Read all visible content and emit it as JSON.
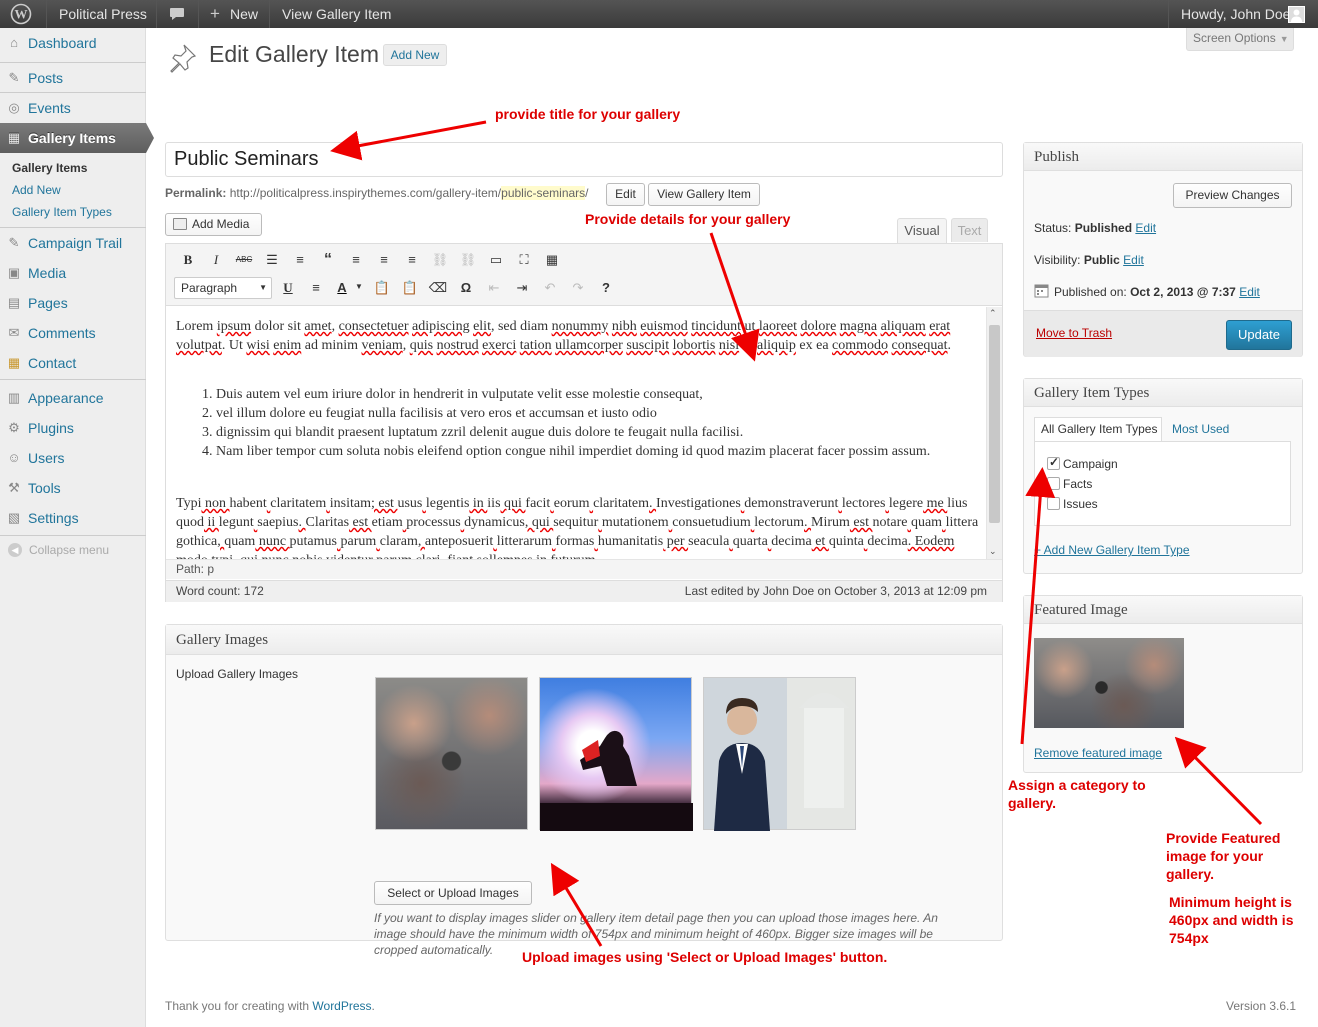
{
  "adminbar": {
    "site_name": "Political Press",
    "new_label": "New",
    "view_item": "View Gallery Item",
    "howdy": "Howdy, John Doe"
  },
  "sidebar": {
    "items": [
      {
        "label": "Dashboard",
        "icon": "⌂"
      },
      {
        "label": "Posts",
        "icon": "✎"
      },
      {
        "label": "Events",
        "icon": "◎"
      },
      {
        "label": "Gallery Items",
        "icon": "▦"
      },
      {
        "label": "Campaign Trail",
        "icon": "✎"
      },
      {
        "label": "Media",
        "icon": "▣"
      },
      {
        "label": "Pages",
        "icon": "▤"
      },
      {
        "label": "Comments",
        "icon": "✉"
      },
      {
        "label": "Contact",
        "icon": "▦"
      },
      {
        "label": "Appearance",
        "icon": "▥"
      },
      {
        "label": "Plugins",
        "icon": "⚙"
      },
      {
        "label": "Users",
        "icon": "☺"
      },
      {
        "label": "Tools",
        "icon": "⚒"
      },
      {
        "label": "Settings",
        "icon": "▧"
      }
    ],
    "submenu": [
      "Gallery Items",
      "Add New",
      "Gallery Item Types"
    ],
    "collapse": "Collapse menu"
  },
  "page": {
    "title": "Edit Gallery Item",
    "add_new": "Add New",
    "screen_options": "Screen Options",
    "post_title": "Public Seminars",
    "permalink_label": "Permalink:",
    "permalink_base": "http://politicalpress.inspirythemes.com/gallery-item/",
    "permalink_slug": "public-seminars",
    "permalink_end": "/",
    "edit_btn": "Edit",
    "view_btn": "View Gallery Item",
    "add_media": "Add Media",
    "tab_visual": "Visual",
    "tab_text": "Text",
    "format_select": "Paragraph"
  },
  "editor": {
    "p1_parts": [
      "Lorem ",
      "ipsum",
      " dolor sit ",
      "amet",
      ", ",
      "consectetuer",
      " ",
      "adipiscing",
      " ",
      "elit",
      ", sed diam ",
      "nonummy",
      " ",
      "nibh",
      " ",
      "euismod",
      " ",
      "tincidunt",
      " ut ",
      "laoreet",
      " ",
      "dolore",
      " ",
      "magna",
      " ",
      "aliquam",
      " ",
      "erat",
      " ",
      "volutpat",
      ". Ut ",
      "wisi",
      " ",
      "enim",
      " ad minim ",
      "veniam",
      ", ",
      "quis",
      " ",
      "nostrud",
      " ",
      "exerci",
      " ",
      "tation",
      " ",
      "ullamcorper",
      " ",
      "suscipit",
      " ",
      "lobortis",
      " ",
      "nisl",
      " ut ",
      "aliquip",
      " ex ea ",
      "commodo",
      " ",
      "consequat",
      "."
    ],
    "list": [
      "Duis autem vel eum iriure dolor in hendrerit in vulputate velit esse molestie consequat,",
      "vel illum dolore eu feugiat nulla facilisis at vero eros et accumsan et iusto odio",
      "dignissim qui blandit praesent luptatum zzril delenit augue duis dolore te feugait nulla facilisi.",
      "Nam liber tempor cum soluta nobis eleifend option congue nihil imperdiet doming id quod mazim placerat facer possim assum."
    ],
    "p2_parts": [
      "Typi",
      " non ",
      "habent",
      " ",
      "claritatem",
      " ",
      "insitam",
      "; est ",
      "usus",
      " ",
      "legentis",
      " in ",
      "iis",
      " qui ",
      "facit",
      " ",
      "eorum",
      " ",
      "claritatem",
      ". ",
      "Investigationes",
      " ",
      "demonstraverunt",
      " ",
      "lectores",
      " ",
      "legere",
      " me ",
      "lius",
      " ",
      "quod",
      " ii ",
      "legunt",
      " ",
      "saepius",
      ". ",
      "Claritas",
      " est ",
      "etiam",
      " ",
      "processus",
      " ",
      "dynamicus",
      ", qui ",
      "sequitur",
      " ",
      "mutationem",
      " ",
      "consuetudium",
      " ",
      "lectorum",
      ". ",
      "Mirum",
      " est ",
      "notare",
      " ",
      "quam",
      " ",
      "littera",
      " ",
      "gothica",
      ", ",
      "quam",
      " nunc ",
      "putamus",
      " ",
      "parum",
      " ",
      "claram",
      ", ",
      "anteposuerit",
      " ",
      "litterarum",
      " ",
      "formas",
      " ",
      "humanitatis",
      " per ",
      "seacula",
      " ",
      "quarta",
      " ",
      "decima",
      " et ",
      "quinta",
      " ",
      "decima",
      ". Eodem modo ",
      "typi",
      ", qui nunc ",
      "nobis",
      " ",
      "videntur",
      " ",
      "parum",
      " ",
      "clari",
      ", fiant ",
      "sollemnes",
      " in ",
      "futurum",
      "."
    ],
    "path": "Path: p",
    "word_count": "Word count: 172",
    "last_edited": "Last edited by John Doe on October 3, 2013 at 12:09 pm"
  },
  "gallery": {
    "title": "Gallery Images",
    "upload_label": "Upload Gallery Images",
    "button": "Select or Upload Images",
    "help": "If you want to display images slider on gallery item detail page then you can upload those images here. An image should have the minimum width of 754px and minimum height of 460px. Bigger size images will be cropped automatically."
  },
  "publish": {
    "title": "Publish",
    "preview": "Preview Changes",
    "status_label": "Status:",
    "status_value": "Published",
    "visibility_label": "Visibility:",
    "visibility_value": "Public",
    "published_label": "Published on:",
    "published_value": "Oct 2, 2013 @ 7:37",
    "edit": "Edit",
    "trash": "Move to Trash",
    "update": "Update"
  },
  "types": {
    "title": "Gallery Item Types",
    "tab_all": "All Gallery Item Types",
    "tab_used": "Most Used",
    "options": [
      {
        "label": "Campaign",
        "checked": true
      },
      {
        "label": "Facts",
        "checked": false
      },
      {
        "label": "Issues",
        "checked": false
      }
    ],
    "add_new": "+ Add New Gallery Item Type"
  },
  "featured": {
    "title": "Featured Image",
    "remove": "Remove featured image"
  },
  "annotations": {
    "title": "provide title for your gallery",
    "details": "Provide details for your gallery",
    "category": "Assign a category to gallery.",
    "featured": "Provide Featured image for your gallery.",
    "size": "Minimum height is 460px and width is 754px",
    "upload": "Upload images using 'Select or Upload Images' button."
  },
  "footer": {
    "thanks": "Thank you for creating with ",
    "wp": "WordPress",
    "dot": ".",
    "version": "Version 3.6.1"
  },
  "colors": {
    "accent": "#21759b",
    "annotation": "#dd0000",
    "update_button": "#2a8bbd"
  }
}
